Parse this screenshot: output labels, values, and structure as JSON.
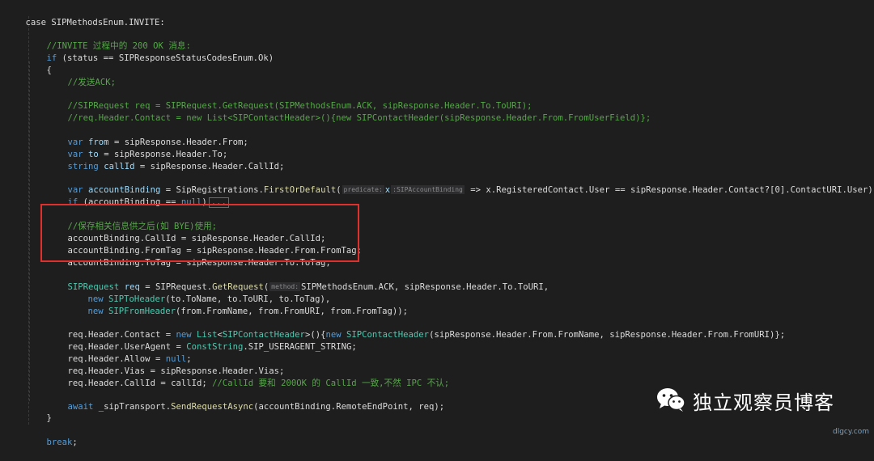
{
  "code": {
    "case_line": "case SIPMethodsEnum.INVITE:",
    "comment_invite": "//INVITE 过程中的 200 OK 消息:",
    "if_status_kw": "if",
    "if_status_rest": " (status == SIPResponseStatusCodesEnum.Ok)",
    "brace_open": "{",
    "comment_send_ack": "//发送ACK;",
    "comment_req_ack": "//SIPRequest req = SIPRequest.GetRequest(SIPMethodsEnum.ACK, sipResponse.Header.To.ToURI);",
    "comment_contact": "//req.Header.Contact = new List<SIPContactHeader>(){new SIPContactHeader(sipResponse.Header.From.FromUserField)};",
    "var_kw": "var",
    "from_name": "from",
    "from_rest": " = sipResponse.Header.From;",
    "to_name": "to",
    "to_rest": " = sipResponse.Header.To;",
    "string_kw": "string",
    "callid_name": "callId",
    "callid_rest": " = sipResponse.Header.CallId;",
    "account_name": "accountBinding",
    "account_assign": " = SipRegistrations.",
    "first_or_default": "FirstOrDefault",
    "paren_open": "(",
    "hint_predicate": "predicate:",
    "lambda_x": "x",
    "hint_type": ":SIPAccountBinding",
    "lambda_rest": " => x.RegisteredContact.User == sipResponse.Header.Contact?[0].ContactURI.User);",
    "if_kw": "if",
    "if_account_rest": " (accountBinding == ",
    "null_kw": "null",
    "paren_close": ")",
    "collapsed": "...",
    "comment_save": "//保存相关信息供之后(如 BYE)使用;",
    "save_callid": "accountBinding.CallId = sipResponse.Header.CallId;",
    "save_fromtag": "accountBinding.FromTag = sipResponse.Header.From.FromTag;",
    "save_totag": "accountBinding.ToTag = sipResponse.Header.To.ToTag;",
    "sip_request_type": "SIPRequest",
    "req_name": "req",
    "req_assign": " = SIPRequest.",
    "get_request": "GetRequest",
    "hint_method": "method:",
    "req_args": "SIPMethodsEnum.ACK, sipResponse.Header.To.ToURI,",
    "new_kw": "new",
    "sip_to_header": "SIPToHeader",
    "to_header_args": "(to.ToName, to.ToURI, to.ToTag),",
    "sip_from_header": "SIPFromHeader",
    "from_header_args": "(from.FromName, from.FromURI, from.FromTag));",
    "contact_left": "req.Header.Contact = ",
    "list_type": "List",
    "contact_generic_open": "<",
    "sip_contact_header": "SIPContactHeader",
    "contact_generic_close": ">(){",
    "contact_args": "(sipResponse.Header.From.FromName, sipResponse.Header.From.FromURI)};",
    "useragent_left": "req.Header.UserAgent = ",
    "const_string": "ConstString",
    "useragent_rest": ".SIP_USERAGENT_STRING;",
    "allow_left": "req.Header.Allow = ",
    "allow_end": ";",
    "vias_line": "req.Header.Vias = sipResponse.Header.Vias;",
    "callid_assign": "req.Header.CallId = callId;",
    "comment_callid": "//CallId 要和 200OK 的 CallId 一致,不然 IPC 不认;",
    "await_kw": "await",
    "await_rest": " _sipTransport.",
    "send_request_async": "SendRequestAsync",
    "await_args": "(accountBinding.RemoteEndPoint, req);",
    "brace_close": "}",
    "break_kw": "break",
    "break_end": ";"
  },
  "watermark": {
    "icon": "wechat-icon",
    "text": "独立观察员博客",
    "site": "dlgcy.com"
  },
  "colors": {
    "background": "#1e1e1e",
    "keyword": "#569cd6",
    "type": "#4ec9b0",
    "comment": "#57a64a",
    "highlight_box": "#e0302d"
  }
}
